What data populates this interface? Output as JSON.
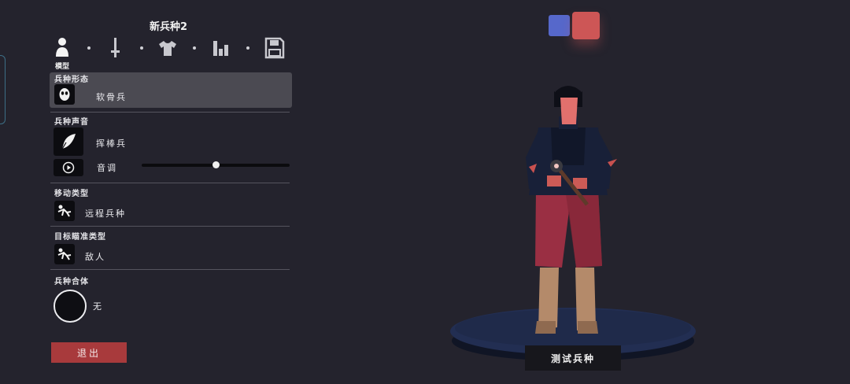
{
  "header": {
    "title": "新兵种2"
  },
  "tabs": [
    {
      "icon": "person-icon",
      "label": "模型",
      "active": true
    },
    {
      "icon": "sword-icon"
    },
    {
      "icon": "shirt-icon"
    },
    {
      "icon": "stats-icon"
    },
    {
      "icon": "save-icon"
    }
  ],
  "sections": {
    "form": {
      "label": "兵种形态",
      "value": "软骨兵",
      "icon": "mask-icon"
    },
    "voice": {
      "label": "兵种声音",
      "value": "挥棒兵",
      "icon": "feather-icon",
      "pitch_label": "音调",
      "pitch_value": 0.5,
      "play_icon": "play-icon"
    },
    "movement": {
      "label": "移动类型",
      "value": "远程兵种",
      "icon": "movement-icon"
    },
    "target": {
      "label": "目标瞄准类型",
      "value": "敌人",
      "icon": "target-icon"
    },
    "merge": {
      "label": "兵种合体",
      "value": "无"
    }
  },
  "buttons": {
    "exit": "退出",
    "test": "测试兵种"
  },
  "team_colors": {
    "blue": "#5668cb",
    "red": "#cd5656"
  }
}
